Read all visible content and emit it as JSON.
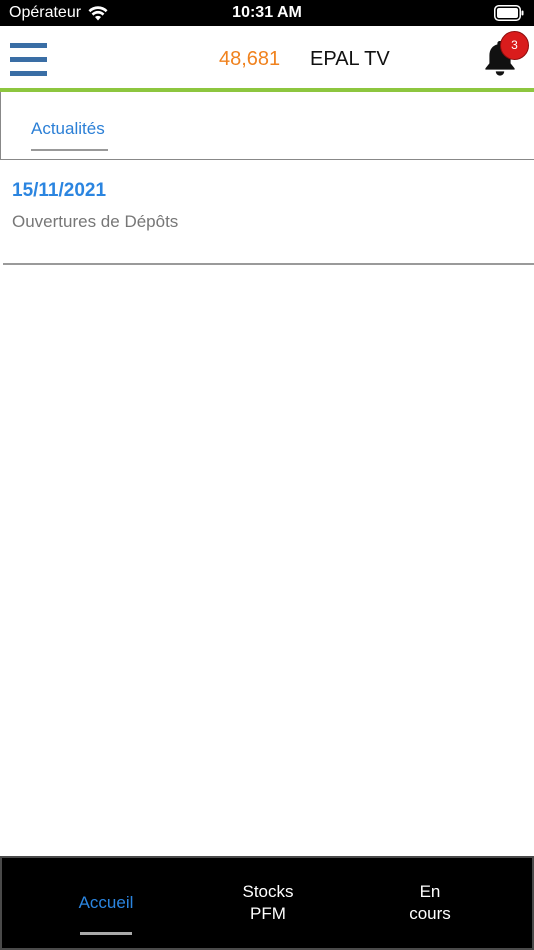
{
  "status_bar": {
    "carrier": "Opérateur",
    "time": "10:31 AM"
  },
  "header": {
    "counter": "48,681",
    "title": "EPAL TV",
    "notification_count": "3",
    "accent_color": "#8dc63f",
    "counter_color": "#f0821e",
    "badge_color": "#d91c1c",
    "menu_icon": "hamburger-menu-icon",
    "bell_icon": "bell-icon"
  },
  "tabs": [
    {
      "label": "Actualités",
      "active": true
    }
  ],
  "news": [
    {
      "date": "15/11/2021",
      "title": "Ouvertures de Dépôts"
    }
  ],
  "bottom_nav": {
    "active_color": "#2b85e0",
    "items": [
      {
        "line1": "Accueil",
        "line2": "",
        "active": true
      },
      {
        "line1": "Stocks",
        "line2": "PFM",
        "active": false
      },
      {
        "line1": "En",
        "line2": "cours",
        "active": false
      }
    ]
  }
}
